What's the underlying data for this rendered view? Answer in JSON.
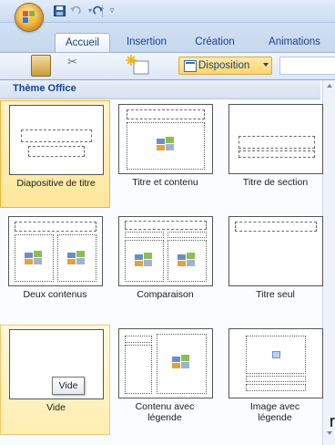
{
  "tabs": [
    {
      "label": "Accueil",
      "active": true
    },
    {
      "label": "Insertion",
      "active": false
    },
    {
      "label": "Création",
      "active": false
    },
    {
      "label": "Animations",
      "active": false
    }
  ],
  "quick_access": {
    "icons": [
      "save-icon",
      "undo-icon",
      "redo-icon",
      "customize-icon"
    ]
  },
  "ribbon": {
    "disposition_label": "Disposition",
    "icons": [
      "paste-icon",
      "cut-icon",
      "new-slide-icon",
      "layout-icon"
    ]
  },
  "gallery": {
    "section_title": "Thème Office",
    "layouts": [
      {
        "label": "Diapositive de titre",
        "state": "selected"
      },
      {
        "label": "Titre et contenu",
        "state": "normal"
      },
      {
        "label": "Titre de section",
        "state": "normal"
      },
      {
        "label": "Deux contenus",
        "state": "normal"
      },
      {
        "label": "Comparaison",
        "state": "normal"
      },
      {
        "label": "Titre seul",
        "state": "normal"
      },
      {
        "label": "Vide",
        "state": "hover"
      },
      {
        "label": "Contenu avec légende",
        "state": "normal"
      },
      {
        "label": "Image avec légende",
        "state": "normal"
      }
    ]
  },
  "tooltip": {
    "text": "Vide"
  },
  "stray_text": "r",
  "colors": {
    "accent": "#15428b",
    "selected_fill": "#ffe79a",
    "selected_border": "#f0b53b"
  }
}
